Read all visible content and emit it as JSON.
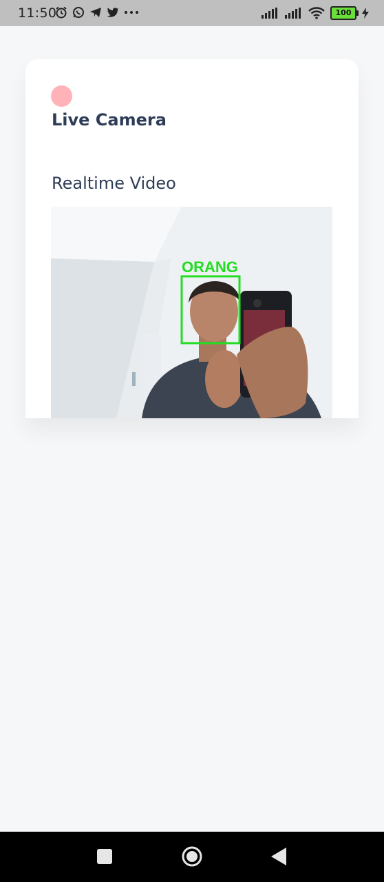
{
  "status_bar": {
    "time": "11:50",
    "battery": "100",
    "left_icons": [
      "alarm-icon",
      "whatsapp-icon",
      "telegram-icon",
      "twitter-icon",
      "more-icon"
    ],
    "right_icons": [
      "signal-icon",
      "signal-icon",
      "wifi-icon",
      "battery-icon",
      "charging-icon"
    ]
  },
  "card": {
    "title": "Live Camera",
    "section_title": "Realtime Video",
    "indicator_color": "#ffb3b8"
  },
  "video": {
    "detection_label": "ORANG",
    "box_color": "#22dd22"
  },
  "nav_bar": {
    "buttons": [
      "recents-button",
      "home-button",
      "back-button"
    ]
  }
}
